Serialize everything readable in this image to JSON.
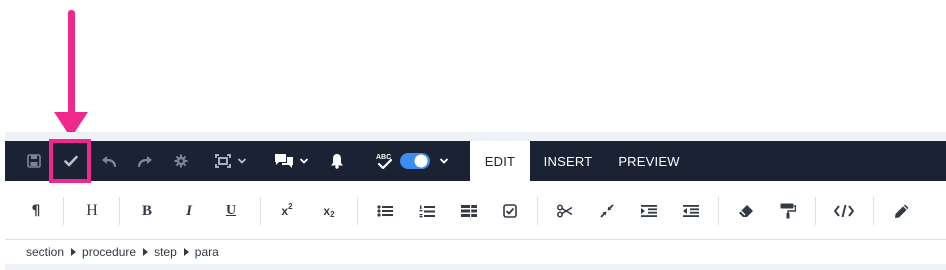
{
  "colors": {
    "toolbar_bg": "#1a2233",
    "annotation": "#f0288c",
    "toggle_on": "#3b8df0"
  },
  "toolbar": {
    "icons": [
      "save-icon",
      "check-icon",
      "undo-icon",
      "redo-icon",
      "settings-icon",
      "fit-frame-icon",
      "comments-icon",
      "notification-bell-icon",
      "spellcheck-icon"
    ],
    "spellcheck_toggle_on": true,
    "tabs": [
      {
        "label": "EDIT",
        "active": true
      },
      {
        "label": "INSERT",
        "active": false
      },
      {
        "label": "PREVIEW",
        "active": false
      }
    ]
  },
  "format": {
    "paragraph": "¶",
    "heading": "H",
    "bold": "B",
    "italic": "I",
    "underline": "U",
    "superscript_base": "x",
    "superscript_mark": "2",
    "subscript_base": "x",
    "subscript_mark": "2",
    "icons": [
      "bullet-list-icon",
      "numbered-list-icon",
      "table-icon",
      "checklist-icon",
      "scissors-icon",
      "collapse-icon",
      "indent-icon",
      "outdent-icon",
      "eraser-icon",
      "paint-roller-icon",
      "code-icon",
      "pencil-icon"
    ]
  },
  "breadcrumb": [
    "section",
    "procedure",
    "step",
    "para"
  ]
}
